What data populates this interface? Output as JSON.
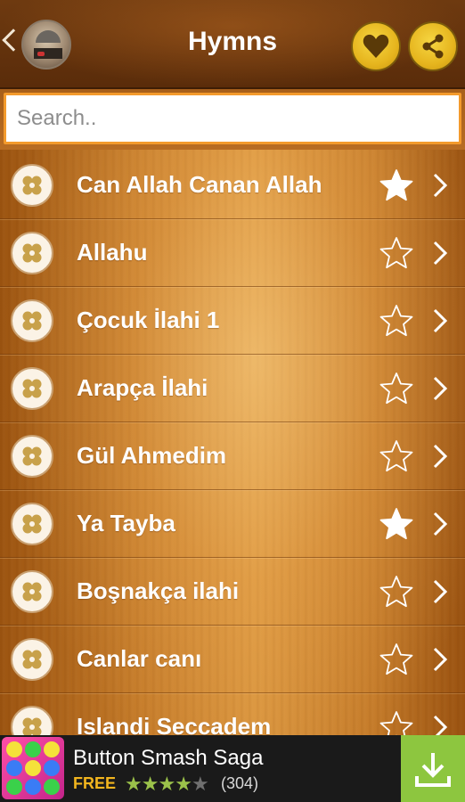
{
  "header": {
    "title": "Hymns",
    "back_icon": "chevron-left-icon",
    "app_icon": "mosque-icon",
    "favorites_icon": "heart-icon",
    "share_icon": "share-icon",
    "accent_color": "#e6b51e"
  },
  "search": {
    "placeholder": "Search..",
    "value": ""
  },
  "hymns": [
    {
      "title": "Can Allah Canan Allah",
      "favorite": true
    },
    {
      "title": "Allahu",
      "favorite": false
    },
    {
      "title": "Çocuk İlahi 1",
      "favorite": false
    },
    {
      "title": "Arapça İlahi",
      "favorite": false
    },
    {
      "title": "Gül Ahmedim",
      "favorite": false
    },
    {
      "title": "Ya Tayba",
      "favorite": true
    },
    {
      "title": "Boşnakça ilahi",
      "favorite": false
    },
    {
      "title": "Canlar canı",
      "favorite": false
    },
    {
      "title": "Islandi Seccadem",
      "favorite": false
    }
  ],
  "ad": {
    "title": "Button Smash Saga",
    "price": "FREE",
    "rating": 4,
    "rating_max": 5,
    "reviews": "(304)",
    "download_icon": "download-icon",
    "download_color": "#8dc63f"
  }
}
